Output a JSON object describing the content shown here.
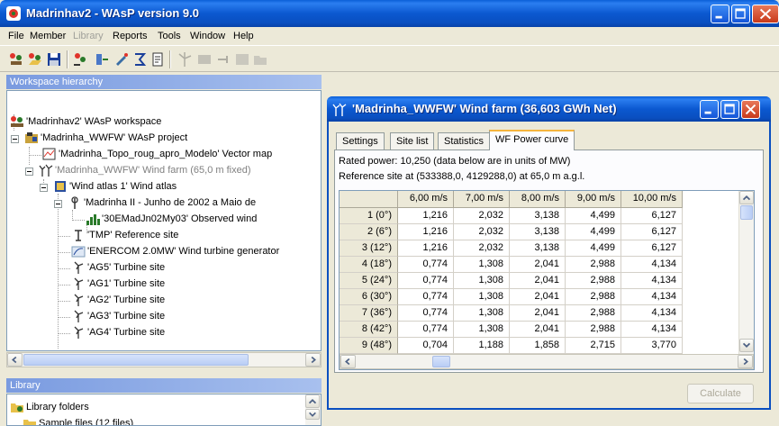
{
  "window": {
    "title": "Madrinhav2 - WAsP version 9.0"
  },
  "menu": [
    {
      "label": "File",
      "enabled": true
    },
    {
      "label": "Member",
      "enabled": true
    },
    {
      "label": "Library",
      "enabled": false
    },
    {
      "label": "Reports",
      "enabled": true
    },
    {
      "label": "Tools",
      "enabled": true
    },
    {
      "label": "Window",
      "enabled": true
    },
    {
      "label": "Help",
      "enabled": true
    }
  ],
  "workspace": {
    "header": "Workspace hierarchy",
    "tree": [
      {
        "label": "'Madrinhav2' WAsP workspace",
        "icon": "workspace-icon"
      },
      {
        "label": "'Madrinha_WWFW' WAsP project",
        "icon": "project-icon"
      },
      {
        "label": "'Madrinha_Topo_roug_apro_Modelo' Vector map",
        "icon": "vector-map-icon"
      },
      {
        "label": "'Madrinha_WWFW' Wind farm (65,0 m fixed)",
        "icon": "wind-farm-icon"
      },
      {
        "label": "'Wind atlas 1' Wind atlas",
        "icon": "wind-atlas-icon"
      },
      {
        "label": "'Madrinha II - Junho de 2002 a Maio de",
        "icon": "met-station-icon"
      },
      {
        "label": "'30EMadJn02My03' Observed wind",
        "icon": "observed-wind-icon"
      },
      {
        "label": "'TMP' Reference site",
        "icon": "reference-site-icon"
      },
      {
        "label": "'ENERCOM 2.0MW' Wind turbine generator",
        "icon": "turbine-generator-icon"
      },
      {
        "label": "'AG5' Turbine site",
        "icon": "turbine-site-icon"
      },
      {
        "label": "'AG1' Turbine site",
        "icon": "turbine-site-icon"
      },
      {
        "label": "'AG2' Turbine site",
        "icon": "turbine-site-icon"
      },
      {
        "label": "'AG3' Turbine site",
        "icon": "turbine-site-icon"
      },
      {
        "label": "'AG4' Turbine site",
        "icon": "turbine-site-icon"
      }
    ]
  },
  "library": {
    "header": "Library",
    "items": [
      {
        "label": "Library folders"
      },
      {
        "label": "Sample files (12 files)"
      }
    ]
  },
  "child": {
    "title": "'Madrinha_WWFW' Wind farm (36,603 GWh Net)",
    "tabs": [
      "Settings",
      "Site list",
      "Statistics",
      "WF Power curve"
    ],
    "active_tab": 3,
    "rated_power": "Rated power: 10,250 (data below are in units of MW)",
    "reference_site": "Reference site at (533388,0, 4129288,0) at 65,0 m a.g.l.",
    "columns": [
      "6,00 m/s",
      "7,00 m/s",
      "8,00 m/s",
      "9,00 m/s",
      "10,00 m/s"
    ],
    "rows": [
      {
        "label": "1 (0°)",
        "values": [
          "1,216",
          "2,032",
          "3,138",
          "4,499",
          "6,127"
        ]
      },
      {
        "label": "2 (6°)",
        "values": [
          "1,216",
          "2,032",
          "3,138",
          "4,499",
          "6,127"
        ]
      },
      {
        "label": "3 (12°)",
        "values": [
          "1,216",
          "2,032",
          "3,138",
          "4,499",
          "6,127"
        ]
      },
      {
        "label": "4 (18°)",
        "values": [
          "0,774",
          "1,308",
          "2,041",
          "2,988",
          "4,134"
        ]
      },
      {
        "label": "5 (24°)",
        "values": [
          "0,774",
          "1,308",
          "2,041",
          "2,988",
          "4,134"
        ]
      },
      {
        "label": "6 (30°)",
        "values": [
          "0,774",
          "1,308",
          "2,041",
          "2,988",
          "4,134"
        ]
      },
      {
        "label": "7 (36°)",
        "values": [
          "0,774",
          "1,308",
          "2,041",
          "2,988",
          "4,134"
        ]
      },
      {
        "label": "8 (42°)",
        "values": [
          "0,774",
          "1,308",
          "2,041",
          "2,988",
          "4,134"
        ]
      },
      {
        "label": "9 (48°)",
        "values": [
          "0,704",
          "1,188",
          "1,858",
          "2,715",
          "3,770"
        ]
      }
    ],
    "calculate_label": "Calculate"
  },
  "colors": {
    "title_blue": "#0a4fc0",
    "panel_header": "#7a9be0",
    "tab_highlight": "#f6b53d"
  }
}
